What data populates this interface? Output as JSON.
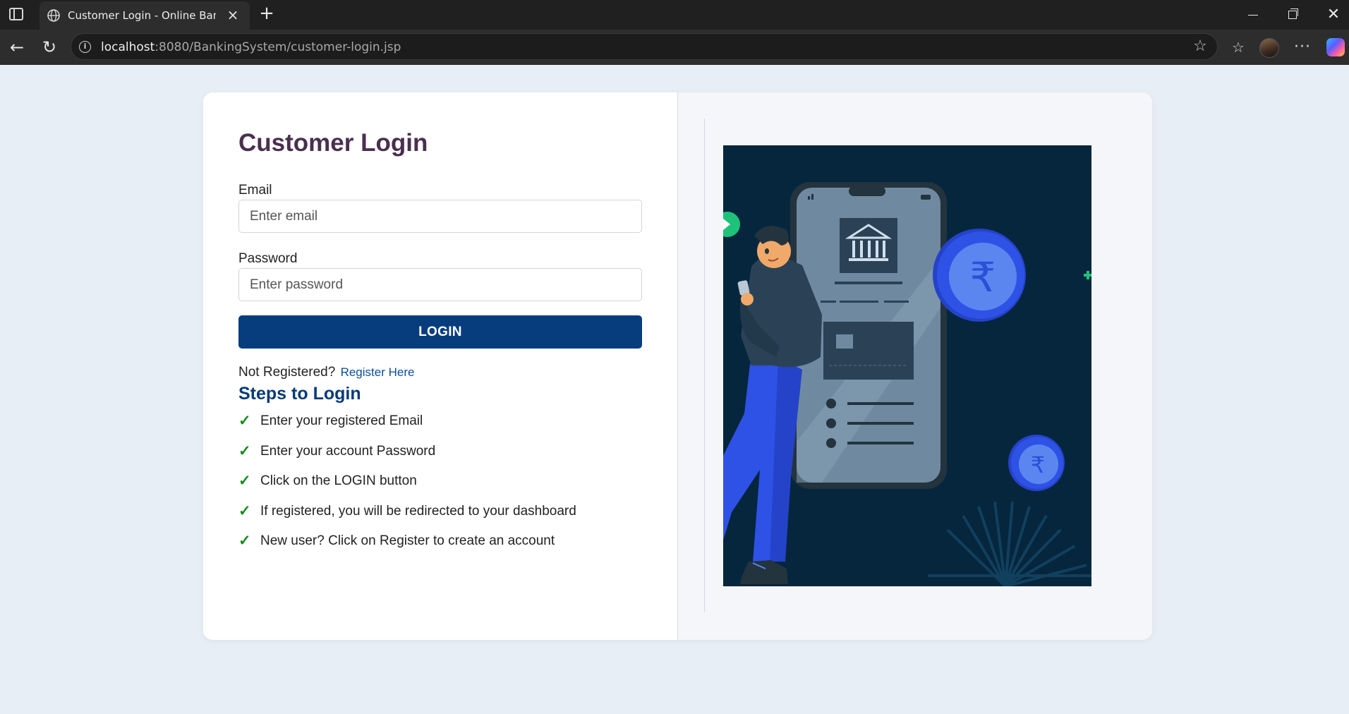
{
  "browser": {
    "tab_title": "Customer Login - Online Banking",
    "url_host": "localhost",
    "url_rest": ":8080/BankingSystem/customer-login.jsp"
  },
  "login": {
    "title": "Customer Login",
    "email_label": "Email",
    "email_placeholder": "Enter email",
    "password_label": "Password",
    "password_placeholder": "Enter password",
    "login_button": "LOGIN",
    "not_registered": "Not Registered?",
    "register_link": "Register Here"
  },
  "steps": {
    "title": "Steps to Login",
    "check_icon": "✓",
    "items": [
      "Enter your registered Email",
      "Enter your account Password",
      "Click on the LOGIN button",
      "If registered, you will be redirected to your dashboard",
      "New user? Click on Register to create an account"
    ]
  },
  "illustration": {
    "icon": "banking-phone-illustration",
    "currency_symbol": "₹"
  },
  "colors": {
    "title": "#4a2f4f",
    "primary": "#083d7d",
    "check": "#148a1f",
    "illustration_bg": "#06263d",
    "coin": "#2e52e6"
  }
}
